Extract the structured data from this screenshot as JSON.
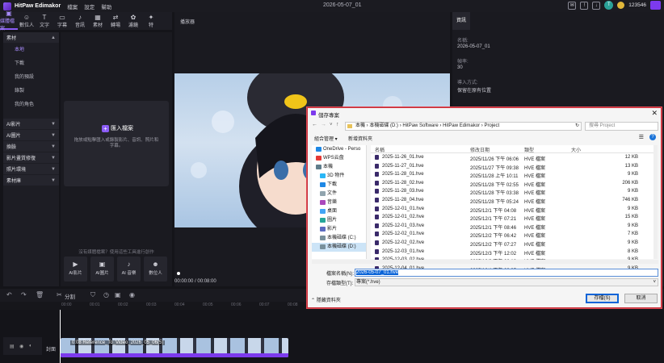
{
  "app": {
    "name": "HitPaw Edimakor",
    "menus": [
      "檔案",
      "設定",
      "幫助"
    ],
    "doc_title": "2026-05-07_01",
    "credits": "123546",
    "avatar_letter": "T"
  },
  "toolbar": [
    {
      "label": "媒體檔案",
      "icon": "folder-icon",
      "glyph": "▣"
    },
    {
      "label": "數位人",
      "icon": "avatar-icon",
      "glyph": "☺"
    },
    {
      "label": "文字",
      "icon": "text-icon",
      "glyph": "T"
    },
    {
      "label": "字幕",
      "icon": "subtitle-icon",
      "glyph": "▭"
    },
    {
      "label": "音訊",
      "icon": "audio-icon",
      "glyph": "♪"
    },
    {
      "label": "素材",
      "icon": "sticker-icon",
      "glyph": "▦"
    },
    {
      "label": "轉場",
      "icon": "transition-icon",
      "glyph": "⇄"
    },
    {
      "label": "濾鏡",
      "icon": "filter-icon",
      "glyph": "✿"
    },
    {
      "label": "特",
      "icon": "effects-icon",
      "glyph": "✦"
    }
  ],
  "sidebar": {
    "sections": [
      {
        "label": "素材",
        "items": [
          "本地",
          "下載",
          "我的預設",
          "錄製",
          "我的角色"
        ]
      },
      {
        "label": "AI影片"
      },
      {
        "label": "AI圖片"
      },
      {
        "label": "換臉"
      },
      {
        "label": "影片畫質修復"
      },
      {
        "label": "照片環境"
      },
      {
        "label": "素材庫"
      }
    ]
  },
  "media": {
    "import_label": "匯入檔案",
    "import_hint": "拖放或點擊匯入或錄製影片、音訊、照片和字幕。",
    "no_material": "沒有媒體檔案？使用這些工具進行創作",
    "ai_tools": [
      "AI影片",
      "AI圖片",
      "AI 音樂",
      "數位人"
    ]
  },
  "player": {
    "title": "播放器",
    "time": "00:00:00 / 00:08:00"
  },
  "info": {
    "tab": "資訊",
    "fields": [
      {
        "label": "名稱:",
        "value": "2026-05-07_01"
      },
      {
        "label": "幀率:",
        "value": "30"
      },
      {
        "label": "導入方式:",
        "value": "保留在原有位置"
      }
    ]
  },
  "timeline": {
    "split_label": "分割",
    "ticks": [
      "00:00",
      "00:01",
      "00:02",
      "00:03",
      "00:04",
      "00:05",
      "00:06",
      "00:07",
      "00:08",
      "00:09",
      "00:10"
    ],
    "track_name": "封面",
    "clip_label": "0:08 Reference_To_Video_2026_05_06(5)"
  },
  "dialog": {
    "title": "儲存專案",
    "breadcrumb": [
      "本機",
      "本機磁碟 (D:)",
      "HitPaw Software",
      "HitPaw Edimakor",
      "Project"
    ],
    "search_placeholder": "搜尋 Project",
    "organize": "組合管理",
    "new_folder": "新增資料夾",
    "nav": [
      "OneDrive - Perso",
      "WPS云盘",
      "本機",
      "3D 物件",
      "下載",
      "文件",
      "音樂",
      "桌面",
      "圖片",
      "影片",
      "本機磁碟 (C:)",
      "本機磁碟 (D:)"
    ],
    "columns": [
      "名稱",
      "修改日期",
      "類型",
      "大小"
    ],
    "files": [
      {
        "name": "2025-11-26_01.hve",
        "date": "2025/11/26 下午 06:06",
        "type": "HVE 檔案",
        "size": "12 KB"
      },
      {
        "name": "2025-11-27_01.hve",
        "date": "2025/11/27 下午 09:38",
        "type": "HVE 檔案",
        "size": "13 KB"
      },
      {
        "name": "2025-11-28_01.hve",
        "date": "2025/11/28 上午 10:11",
        "type": "HVE 檔案",
        "size": "9 KB"
      },
      {
        "name": "2025-11-28_02.hve",
        "date": "2025/11/28 下午 02:55",
        "type": "HVE 檔案",
        "size": "206 KB"
      },
      {
        "name": "2025-11-28_03.hve",
        "date": "2025/11/28 下午 03:38",
        "type": "HVE 檔案",
        "size": "9 KB"
      },
      {
        "name": "2025-11-28_04.hve",
        "date": "2025/11/28 下午 05:24",
        "type": "HVE 檔案",
        "size": "746 KB"
      },
      {
        "name": "2025-12-01_01.hve",
        "date": "2025/12/1 下午 04:08",
        "type": "HVE 檔案",
        "size": "9 KB"
      },
      {
        "name": "2025-12-01_02.hve",
        "date": "2025/12/1 下午 07:21",
        "type": "HVE 檔案",
        "size": "15 KB"
      },
      {
        "name": "2025-12-01_03.hve",
        "date": "2025/12/1 下午 08:46",
        "type": "HVE 檔案",
        "size": "9 KB"
      },
      {
        "name": "2025-12-02_01.hve",
        "date": "2025/12/2 下午 06:42",
        "type": "HVE 檔案",
        "size": "7 KB"
      },
      {
        "name": "2025-12-02_02.hve",
        "date": "2025/12/2 下午 07:27",
        "type": "HVE 檔案",
        "size": "9 KB"
      },
      {
        "name": "2025-12-03_01.hve",
        "date": "2025/12/3 下午 12:02",
        "type": "HVE 檔案",
        "size": "8 KB"
      },
      {
        "name": "2025-12-03_02.hve",
        "date": "2025/12/3 下午 02:18",
        "type": "HVE 檔案",
        "size": "9 KB"
      },
      {
        "name": "2025-12-04_01.hve",
        "date": "2025/12/4 下午 03:35",
        "type": "HVE 檔案",
        "size": "9 KB"
      }
    ],
    "filename_label": "檔案名稱(N):",
    "filename_value": "2026-05-07_01.hve",
    "filetype_label": "存檔類型(T):",
    "filetype_value": "專案(*.hve)",
    "hide_folders": "隱藏資料夾",
    "save_label": "存檔(S)",
    "cancel_label": "取消"
  },
  "colors": {
    "accent": "#8b5cf6",
    "dialog_border": "#c8303a",
    "clip_bar": "#7c3aed"
  }
}
